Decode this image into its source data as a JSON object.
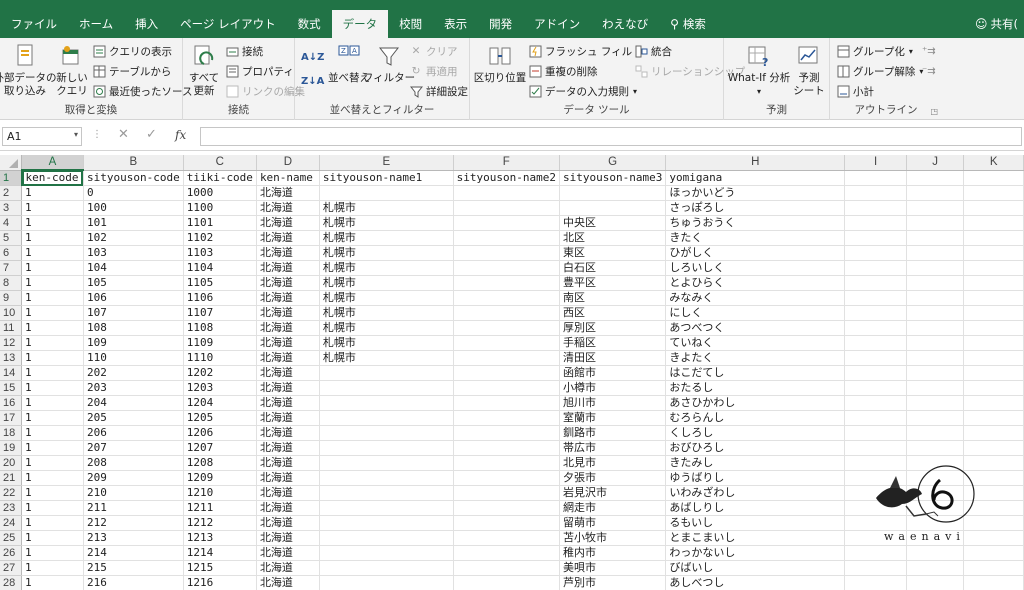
{
  "ribbon_tabs": [
    {
      "label": "ファイル"
    },
    {
      "label": "ホーム"
    },
    {
      "label": "挿入"
    },
    {
      "label": "ページ レイアウト"
    },
    {
      "label": "数式"
    },
    {
      "label": "データ"
    },
    {
      "label": "校閲"
    },
    {
      "label": "表示"
    },
    {
      "label": "開発"
    },
    {
      "label": "アドイン"
    },
    {
      "label": "わえなび"
    },
    {
      "label": "検索"
    }
  ],
  "share_label": "共有(",
  "ribbon": {
    "get_transform": {
      "label": "取得と変換",
      "external_data": "外部データの\n取り込み",
      "new_query": "新しい\nクエリ",
      "show_queries": "クエリの表示",
      "from_table": "テーブルから",
      "recent_sources": "最近使ったソース"
    },
    "connections": {
      "label": "接続",
      "refresh_all": "すべて\n更新",
      "connections": "接続",
      "properties": "プロパティ",
      "edit_links": "リンクの編集"
    },
    "sort_filter": {
      "label": "並べ替えとフィルター",
      "sort": "並べ替え",
      "filter": "フィルター",
      "clear": "クリア",
      "reapply": "再適用",
      "advanced": "詳細設定"
    },
    "data_tools": {
      "label": "データ ツール",
      "text_to_columns": "区切り位置",
      "flash_fill": "フラッシュ フィル",
      "remove_duplicates": "重複の削除",
      "data_validation": "データの入力規則",
      "consolidate": "統合",
      "relationships": "リレーションシップ"
    },
    "forecast": {
      "label": "予測",
      "what_if": "What-If 分析",
      "forecast_sheet": "予測\nシート"
    },
    "outline": {
      "label": "アウトライン",
      "group": "グループ化",
      "ungroup": "グループ解除",
      "subtotal": "小計"
    }
  },
  "formula_bar": {
    "name_box": "A1",
    "fx": "fx",
    "content": ""
  },
  "columns": [
    "A",
    "B",
    "C",
    "D",
    "E",
    "F",
    "G",
    "H",
    "I",
    "J",
    "K"
  ],
  "rows": [
    [
      "ken-code",
      "sityouson-code",
      "tiiki-code",
      "ken-name",
      "sityouson-name1",
      "sityouson-name2",
      "sityouson-name3",
      "yomigana"
    ],
    [
      "1",
      "0",
      "1000",
      "北海道",
      "",
      "",
      "",
      "ほっかいどう"
    ],
    [
      "1",
      "100",
      "1100",
      "北海道",
      "札幌市",
      "",
      "",
      "さっぽろし"
    ],
    [
      "1",
      "101",
      "1101",
      "北海道",
      "札幌市",
      "",
      "中央区",
      "ちゅうおうく"
    ],
    [
      "1",
      "102",
      "1102",
      "北海道",
      "札幌市",
      "",
      "北区",
      "きたく"
    ],
    [
      "1",
      "103",
      "1103",
      "北海道",
      "札幌市",
      "",
      "東区",
      "ひがしく"
    ],
    [
      "1",
      "104",
      "1104",
      "北海道",
      "札幌市",
      "",
      "白石区",
      "しろいしく"
    ],
    [
      "1",
      "105",
      "1105",
      "北海道",
      "札幌市",
      "",
      "豊平区",
      "とよひらく"
    ],
    [
      "1",
      "106",
      "1106",
      "北海道",
      "札幌市",
      "",
      "南区",
      "みなみく"
    ],
    [
      "1",
      "107",
      "1107",
      "北海道",
      "札幌市",
      "",
      "西区",
      "にしく"
    ],
    [
      "1",
      "108",
      "1108",
      "北海道",
      "札幌市",
      "",
      "厚別区",
      "あつべつく"
    ],
    [
      "1",
      "109",
      "1109",
      "北海道",
      "札幌市",
      "",
      "手稲区",
      "ていねく"
    ],
    [
      "1",
      "110",
      "1110",
      "北海道",
      "札幌市",
      "",
      "清田区",
      "きよたく"
    ],
    [
      "1",
      "202",
      "1202",
      "北海道",
      "",
      "",
      "函館市",
      "はこだてし"
    ],
    [
      "1",
      "203",
      "1203",
      "北海道",
      "",
      "",
      "小樽市",
      "おたるし"
    ],
    [
      "1",
      "204",
      "1204",
      "北海道",
      "",
      "",
      "旭川市",
      "あさひかわし"
    ],
    [
      "1",
      "205",
      "1205",
      "北海道",
      "",
      "",
      "室蘭市",
      "むろらんし"
    ],
    [
      "1",
      "206",
      "1206",
      "北海道",
      "",
      "",
      "釧路市",
      "くしろし"
    ],
    [
      "1",
      "207",
      "1207",
      "北海道",
      "",
      "",
      "帯広市",
      "おびひろし"
    ],
    [
      "1",
      "208",
      "1208",
      "北海道",
      "",
      "",
      "北見市",
      "きたみし"
    ],
    [
      "1",
      "209",
      "1209",
      "北海道",
      "",
      "",
      "夕張市",
      "ゆうばりし"
    ],
    [
      "1",
      "210",
      "1210",
      "北海道",
      "",
      "",
      "岩見沢市",
      "いわみざわし"
    ],
    [
      "1",
      "211",
      "1211",
      "北海道",
      "",
      "",
      "網走市",
      "あばしりし"
    ],
    [
      "1",
      "212",
      "1212",
      "北海道",
      "",
      "",
      "留萌市",
      "るもいし"
    ],
    [
      "1",
      "213",
      "1213",
      "北海道",
      "",
      "",
      "苫小牧市",
      "とまこまいし"
    ],
    [
      "1",
      "214",
      "1214",
      "北海道",
      "",
      "",
      "稚内市",
      "わっかないし"
    ],
    [
      "1",
      "215",
      "1215",
      "北海道",
      "",
      "",
      "美唄市",
      "びばいし"
    ],
    [
      "1",
      "216",
      "1216",
      "北海道",
      "",
      "",
      "芦別市",
      "あしべつし"
    ]
  ],
  "watermark": {
    "text": "waenavi"
  },
  "colors": {
    "accent": "#217346",
    "grid": "#e1e1e1"
  }
}
